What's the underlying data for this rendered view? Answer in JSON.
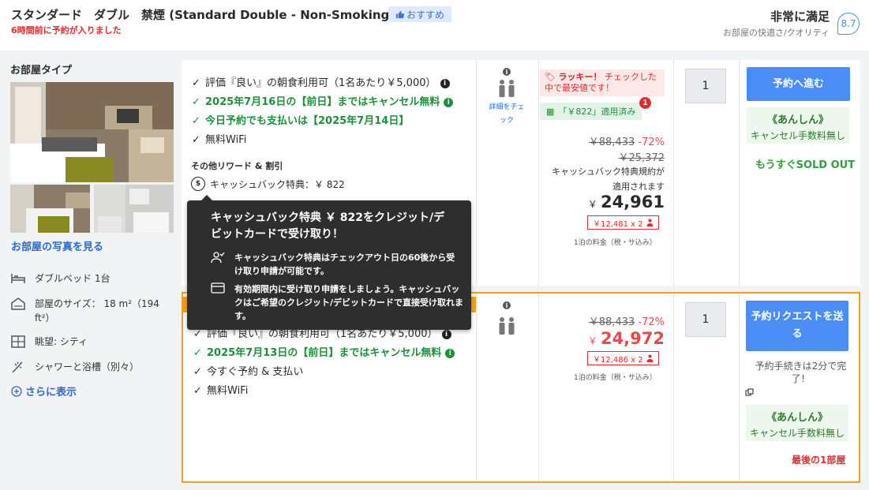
{
  "header": {
    "room_title": "スタンダード　ダブル　禁煙 (Standard Double - Non-Smoking)",
    "recommend_badge": "おすすめ",
    "booked_recent": "6時間前に予約が入りました",
    "review_word": "非常に満足",
    "review_sub": "お部屋の快適さ/クオリティ",
    "review_score": "8.7"
  },
  "left": {
    "heading": "お部屋タイプ",
    "view_photos": "お部屋の写真を見る",
    "features": [
      {
        "icon": "bed-icon",
        "label": "ダブルベッド 1台"
      },
      {
        "icon": "room-size-icon",
        "label": "部屋のサイズ： 18 m²（194 ft²）"
      },
      {
        "icon": "window-view-icon",
        "label": "眺望: シティ"
      },
      {
        "icon": "shower-icon",
        "label": "シャワーと浴槽（別々）"
      }
    ],
    "show_more": "さらに表示"
  },
  "offer1": {
    "benefits": [
      {
        "text": "評価『良い』の朝食利用可（1名あたり￥5,000）",
        "green": false,
        "info": true
      },
      {
        "text": "2025年7月16日の【前日】まではキャンセル無料",
        "green": true,
        "info": true
      },
      {
        "text": "今日予約でも支払いは【2025年7月14日】",
        "green": true,
        "info": false
      },
      {
        "text": "無料WiFi",
        "green": false,
        "info": false
      }
    ],
    "rewards_title": "その他リワード & 割引",
    "cashback": "キャッシュバック特典：￥ 822",
    "occupancy_link": "詳細をチェック",
    "lucky_label": "ラッキー！",
    "lucky_text": "チェックした中で最安値です！",
    "applied_text": "「￥822」適用済み",
    "applied_badge": "1",
    "original_price": "￥88,433",
    "discount": "-72%",
    "second_price": "￥25,372",
    "cashback_note": "キャッシュバック特典規約が適用されます",
    "currency": "￥",
    "price": "24,961",
    "per_person": "￥12,481 x 2",
    "per_night": "1泊の料金（税・サ込み）",
    "quantity": "1",
    "reserve_button": "予約へ進む",
    "anshin_title": "《あんしん》",
    "anshin_sub": "キャンセル手数料無し",
    "soldout": "もうすぐSOLD OUT"
  },
  "offer2": {
    "benefits": [
      {
        "text": "評価『良い』の朝食利用可（1名あたり￥5,000）",
        "green": false,
        "info": true
      },
      {
        "text": "2025年7月13日の【前日】まではキャンセル無料",
        "green": true,
        "info": true
      },
      {
        "text": "今すぐ予約 & 支払い",
        "green": false,
        "info": false
      },
      {
        "text": "無料WiFi",
        "green": false,
        "info": false
      }
    ],
    "original_price": "￥88,433",
    "discount": "-72%",
    "currency": "￥",
    "price": "24,972",
    "per_person": "￥12,486 x 2",
    "per_night": "1泊の料金（税・サ込み）",
    "quantity": "1",
    "reserve_button": "予約リクエストを送る",
    "quick_note": "予約手続きは2分で完了！",
    "anshin_title": "《あんしん》",
    "anshin_sub": "キャンセル手数料無し",
    "last_room": "最後の1部屋"
  },
  "tooltip": {
    "title": "キャッシュバック特典 ￥ 822をクレジット/デビットカードで受け取り！",
    "row1": "キャッシュバック特典はチェックアウト日の60後から受け取り申請が可能です。",
    "row2": "有効期限内に受け取り申請をしましょう。キャッシュバックはご希望のクレジット/デビットカードで直接受け取れます。"
  },
  "colors": {
    "accent_blue": "#4a8df5",
    "green": "#1e8f3a",
    "red": "#e12d2d",
    "orange": "#f5a21e"
  }
}
